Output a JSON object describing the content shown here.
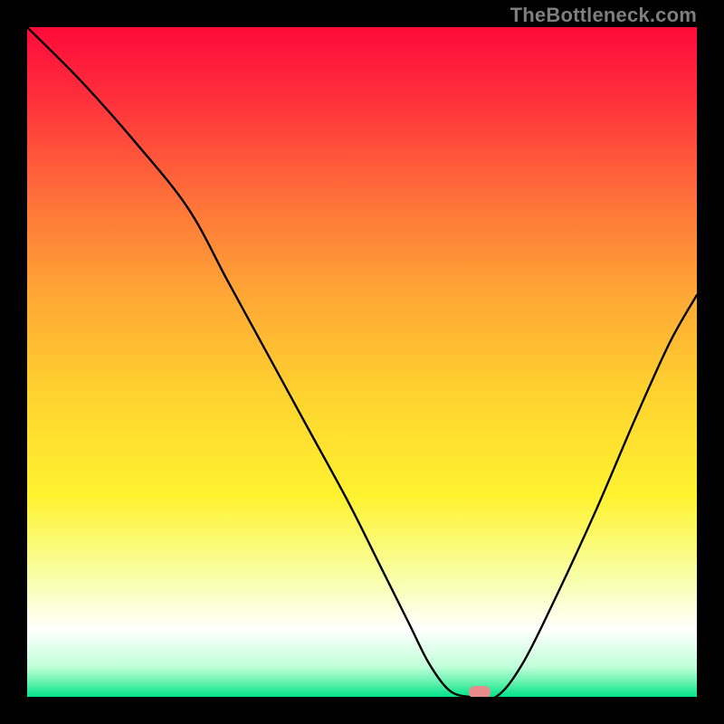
{
  "watermark": "TheBottleneck.com",
  "chart_data": {
    "type": "line",
    "title": "",
    "xlabel": "",
    "ylabel": "",
    "xlim": [
      0,
      100
    ],
    "ylim": [
      0,
      100
    ],
    "grid": false,
    "legend": false,
    "background_gradient": {
      "stops": [
        {
          "pos": 0.0,
          "color": "#ff0a3a"
        },
        {
          "pos": 0.1,
          "color": "#ff2d3c"
        },
        {
          "pos": 0.25,
          "color": "#ff6e3a"
        },
        {
          "pos": 0.4,
          "color": "#ffa735"
        },
        {
          "pos": 0.55,
          "color": "#ffd32f"
        },
        {
          "pos": 0.7,
          "color": "#fff22f"
        },
        {
          "pos": 0.82,
          "color": "#f8ffa5"
        },
        {
          "pos": 0.9,
          "color": "#ffffff"
        },
        {
          "pos": 0.955,
          "color": "#c0ffd8"
        },
        {
          "pos": 0.978,
          "color": "#66f2b0"
        },
        {
          "pos": 1.0,
          "color": "#00e389"
        }
      ]
    },
    "series": [
      {
        "name": "curve",
        "color": "#000000",
        "x": [
          0,
          8,
          16,
          24,
          30,
          36,
          42,
          48,
          53,
          57,
          60,
          63,
          66,
          70,
          74,
          79,
          85,
          91,
          96,
          100
        ],
        "y": [
          100,
          92,
          83,
          73,
          62,
          51,
          40,
          29,
          19,
          11,
          5,
          1,
          0,
          0,
          5,
          15,
          28,
          42,
          53,
          60
        ]
      }
    ],
    "marker": {
      "x": 67.5,
      "y": 0,
      "color": "#e88b8b"
    }
  }
}
